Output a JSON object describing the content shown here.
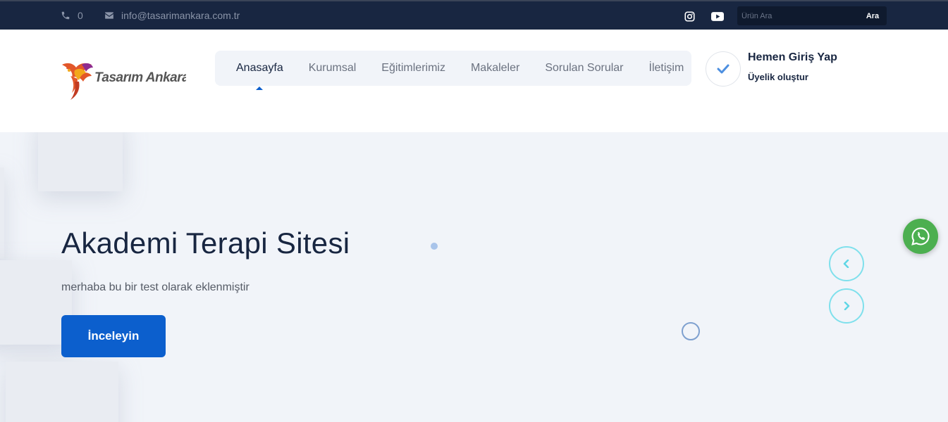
{
  "topbar": {
    "phone": "0",
    "email": "info@tasarimankara.com.tr",
    "social": [
      {
        "name": "instagram-icon"
      },
      {
        "name": "youtube-icon"
      }
    ],
    "search": {
      "placeholder": "Ürün Ara",
      "button_label": "Ara"
    }
  },
  "header": {
    "logo_text": "Tasarım Ankara",
    "nav": [
      {
        "label": "Anasayfa",
        "active": true
      },
      {
        "label": "Kurumsal",
        "active": false
      },
      {
        "label": "Eğitimlerimiz",
        "active": false
      },
      {
        "label": "Makaleler",
        "active": false
      },
      {
        "label": "Sorulan Sorular",
        "active": false
      },
      {
        "label": "İletişim",
        "active": false
      }
    ],
    "login": {
      "title": "Hemen Giriş Yap",
      "subtitle": "Üyelik oluştur"
    }
  },
  "hero": {
    "title": "Akademi Terapi Sitesi",
    "subtitle": "merhaba bu bir test olarak eklenmiştir",
    "button_label": "İnceleyin"
  },
  "colors": {
    "topbar_bg": "#182641",
    "accent": "#0c5fcd",
    "arrow_ring": "#7fe0ec",
    "whatsapp": "#4caf50"
  }
}
